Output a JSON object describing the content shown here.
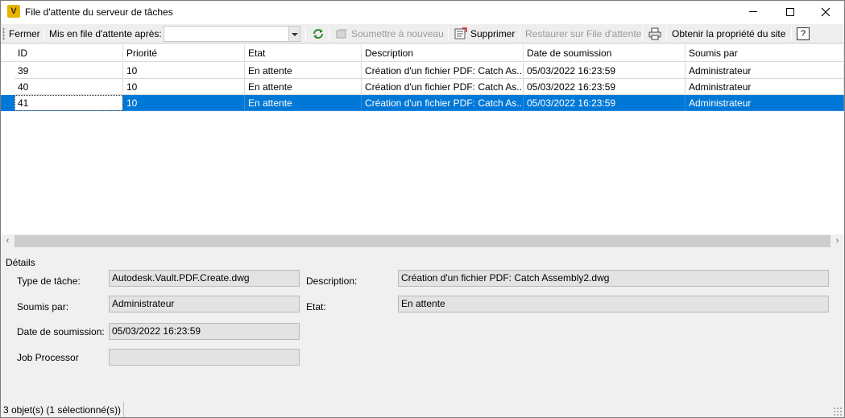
{
  "window": {
    "title": "File d'attente du serveur de tâches",
    "app_icon_letter": "V"
  },
  "toolbar": {
    "close_label": "Fermer",
    "queue_after_label": "Mis en file d'attente après:",
    "queue_after_value": "",
    "refresh_icon": "refresh-icon",
    "resubmit_label": "Soumettre à nouveau",
    "delete_label": "Supprimer",
    "restore_label": "Restaurer sur File d'attente",
    "print_icon": "print-icon",
    "ownership_label": "Obtenir la propriété du site",
    "help_label": "?"
  },
  "grid": {
    "columns": [
      "ID",
      "Priorité",
      "Etat",
      "Description",
      "Date de soumission",
      "Soumis par"
    ],
    "rows": [
      [
        "39",
        "10",
        "En attente",
        "Création d'un fichier PDF: Catch As...",
        "05/03/2022 16:23:59",
        "Administrateur"
      ],
      [
        "40",
        "10",
        "En attente",
        "Création d'un fichier PDF: Catch As...",
        "05/03/2022 16:23:59",
        "Administrateur"
      ],
      [
        "41",
        "10",
        "En attente",
        "Création d'un fichier PDF: Catch As...",
        "05/03/2022 16:23:59",
        "Administrateur"
      ]
    ],
    "selected_row": 2
  },
  "details": {
    "title": "Détails",
    "task_type_label": "Type de tâche:",
    "task_type_value": "Autodesk.Vault.PDF.Create.dwg",
    "submitted_by_label": "Soumis par:",
    "submitted_by_value": "Administrateur",
    "submit_date_label": "Date de soumission:",
    "submit_date_value": "05/03/2022 16:23:59",
    "job_processor_label": "Job Processor",
    "job_processor_value": "",
    "description_label": "Description:",
    "description_value": "Création d'un fichier PDF: Catch Assembly2.dwg",
    "state_label": "Etat:",
    "state_value": "En attente"
  },
  "status": {
    "text": "3 objet(s) (1 sélectionné(s))"
  },
  "colors": {
    "selection": "#0078d7",
    "field_background": "#e3e3e3"
  }
}
